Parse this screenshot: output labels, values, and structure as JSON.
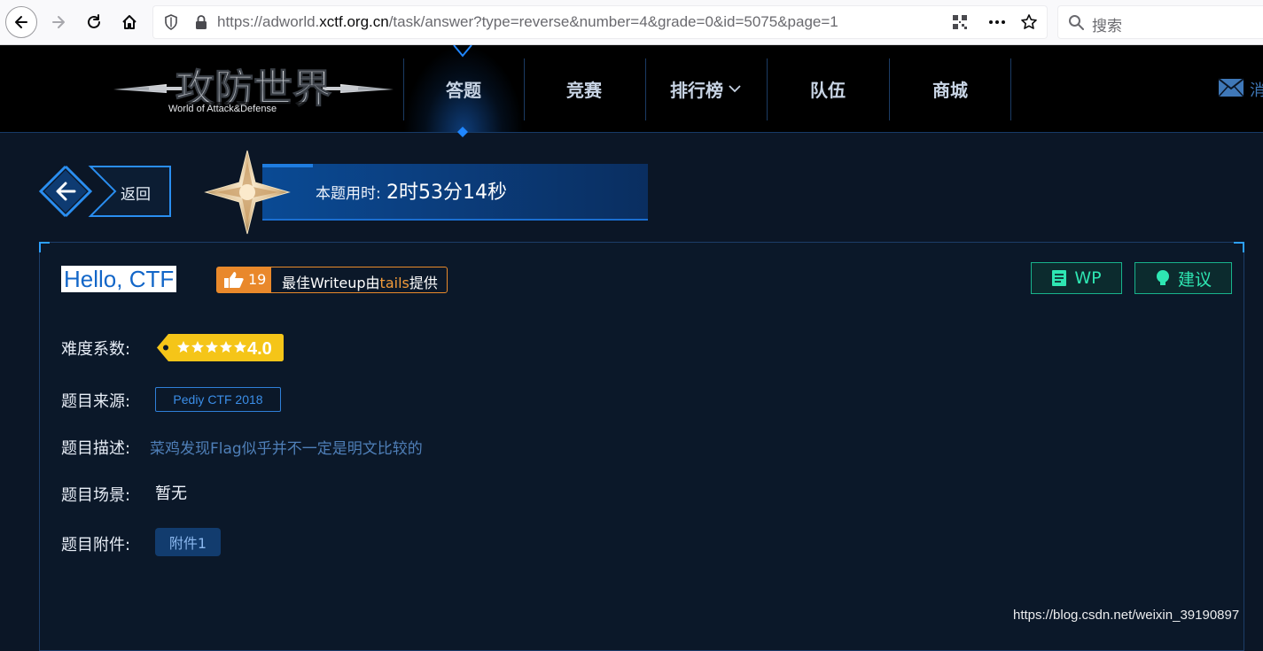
{
  "browser": {
    "url_prefix": "https://adworld.",
    "url_host": "xctf.org.cn",
    "url_path": "/task/answer?type=reverse&number=4&grade=0&id=5075&page=1",
    "search_placeholder": "搜索"
  },
  "site": {
    "logo_text": "攻防世界",
    "logo_subtext": "World of Attack&Defense",
    "nav": [
      {
        "label": "答题",
        "active": true
      },
      {
        "label": "竞赛"
      },
      {
        "label": "排行榜"
      },
      {
        "label": "队伍"
      },
      {
        "label": "商城"
      }
    ],
    "message_label": "消"
  },
  "timer": {
    "back_label": "返回",
    "label": "本题用时:",
    "value": "2时53分14秒"
  },
  "task": {
    "title": "Hello, CTF",
    "likes": "19",
    "writeup_prefix": "最佳Writeup由",
    "writeup_author": "tails",
    "writeup_suffix": "提供",
    "wp_label": "WP",
    "suggest_label": "建议",
    "difficulty_label": "难度系数:",
    "difficulty_value": "4.0",
    "difficulty_stars": 5,
    "source_label": "题目来源:",
    "source_value": "Pediy CTF 2018",
    "desc_label": "题目描述:",
    "desc_value": "菜鸡发现Flag似乎并不一定是明文比较的",
    "scene_label": "题目场景:",
    "scene_value": "暂无",
    "attach_label": "题目附件:",
    "attach_value": "附件1"
  },
  "colors": {
    "accent_blue": "#1a6ed0",
    "badge_orange": "#e9882b",
    "action_green": "#2ee6b2",
    "difficulty_yellow": "#f5c518"
  },
  "watermark": "https://blog.csdn.net/weixin_39190897"
}
